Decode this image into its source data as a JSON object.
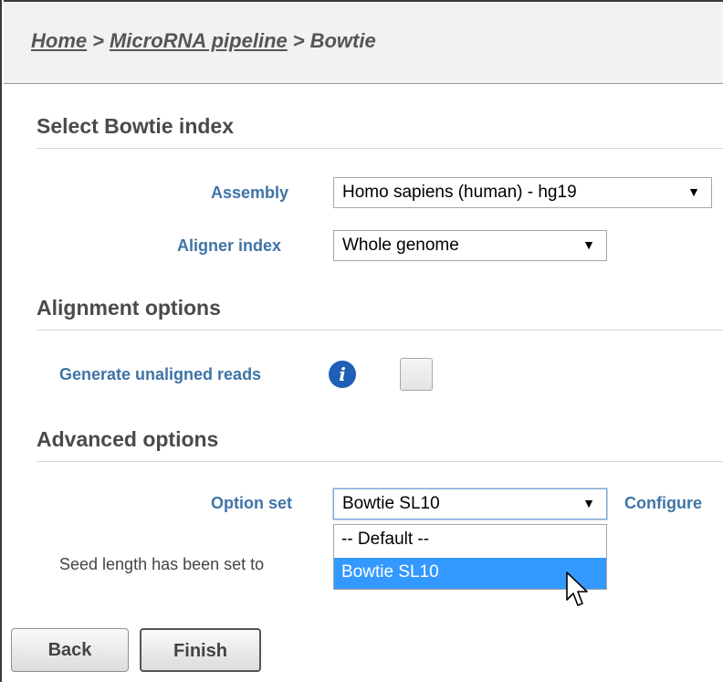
{
  "breadcrumb": {
    "items": [
      "Home",
      "MicroRNA pipeline",
      "Bowtie"
    ],
    "separator": ">"
  },
  "sections": {
    "index": {
      "title": "Select Bowtie index",
      "assembly_label": "Assembly",
      "assembly_value": "Homo sapiens (human) - hg19",
      "aligner_label": "Aligner index",
      "aligner_value": "Whole genome"
    },
    "alignment": {
      "title": "Alignment options",
      "unaligned_label": "Generate unaligned reads",
      "unaligned_checked": false
    },
    "advanced": {
      "title": "Advanced options",
      "option_set_label": "Option set",
      "option_set_value": "Bowtie SL10",
      "options": [
        "-- Default --",
        "Bowtie SL10"
      ],
      "selected_option": "Bowtie SL10",
      "configure_label": "Configure",
      "help_text": "Seed length has been set to"
    }
  },
  "buttons": {
    "back": "Back",
    "finish": "Finish"
  },
  "icons": {
    "info": "info-icon",
    "dropdown": "caret-down-icon",
    "cursor": "mouse-pointer-icon"
  },
  "colors": {
    "label": "#3f74a6",
    "selection": "#3399ff",
    "info": "#1f5fb8"
  }
}
